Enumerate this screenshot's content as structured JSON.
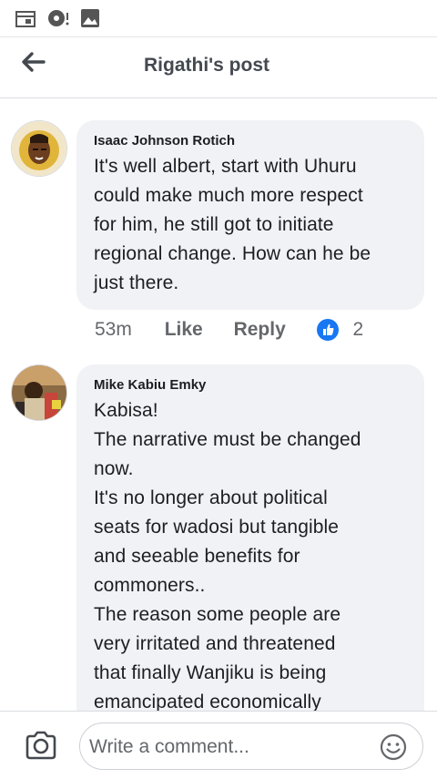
{
  "header": {
    "title": "Rigathi's post"
  },
  "comments": [
    {
      "author": "Isaac Johnson Rotich",
      "text": "It's well albert, start with Uhuru\ncould make much more respect\nfor him, he still got to initiate\nregional change. How can he be\njust there.",
      "time": "53m",
      "like_label": "Like",
      "reply_label": "Reply",
      "reaction_count": "2"
    },
    {
      "author": "Mike Kabiu Emky",
      "text": "Kabisa!\nThe narrative must be changed\nnow.\nIt's no longer about political\nseats for wadosi but tangible\nand seeable benefits for\ncommoners..\nThe reason some people are\nvery irritated and threatened\nthat finally Wanjiku is being\nemancipated economically"
    }
  ],
  "composer": {
    "placeholder": "Write a comment..."
  },
  "colors": {
    "accent": "#1877f2",
    "bubble": "#f0f2f5",
    "meta": "#65676b"
  },
  "icons": [
    "calendar-icon",
    "media-player-icon",
    "image-icon",
    "back-arrow-icon",
    "like-icon",
    "camera-icon",
    "emoji-icon"
  ]
}
